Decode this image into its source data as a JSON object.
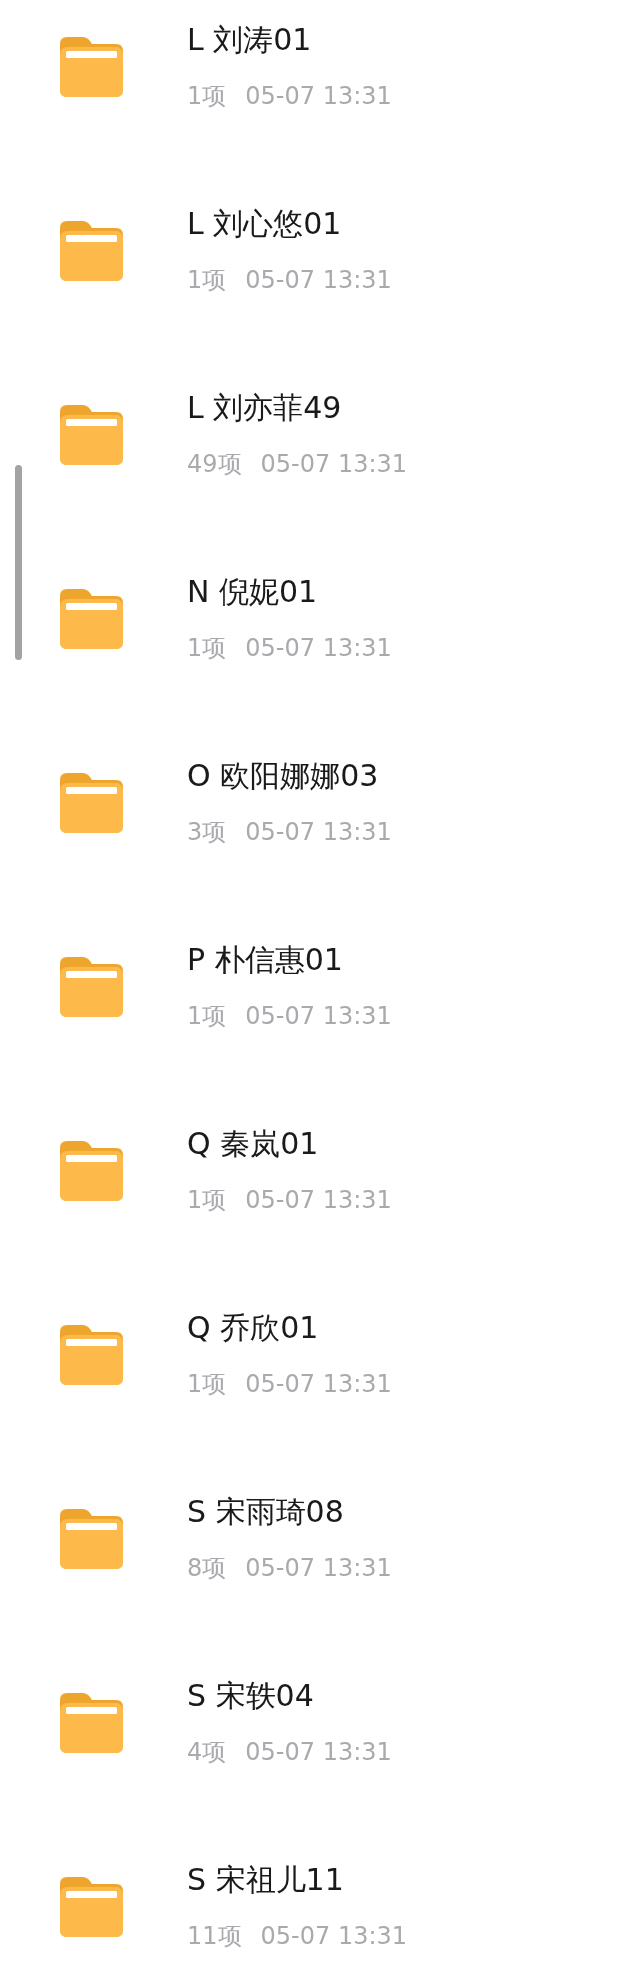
{
  "folders": [
    {
      "name": "L 刘涛01",
      "count": "1项",
      "time": "05-07 13:31"
    },
    {
      "name": "L 刘心悠01",
      "count": "1项",
      "time": "05-07 13:31"
    },
    {
      "name": "L 刘亦菲49",
      "count": "49项",
      "time": "05-07 13:31"
    },
    {
      "name": "N 倪妮01",
      "count": "1项",
      "time": "05-07 13:31"
    },
    {
      "name": "O 欧阳娜娜03",
      "count": "3项",
      "time": "05-07 13:31"
    },
    {
      "name": "P 朴信惠01",
      "count": "1项",
      "time": "05-07 13:31"
    },
    {
      "name": "Q 秦岚01",
      "count": "1项",
      "time": "05-07 13:31"
    },
    {
      "name": "Q 乔欣01",
      "count": "1项",
      "time": "05-07 13:31"
    },
    {
      "name": "S 宋雨琦08",
      "count": "8项",
      "time": "05-07 13:31"
    },
    {
      "name": "S 宋轶04",
      "count": "4项",
      "time": "05-07 13:31"
    },
    {
      "name": "S 宋祖儿11",
      "count": "11项",
      "time": "05-07 13:31"
    }
  ]
}
